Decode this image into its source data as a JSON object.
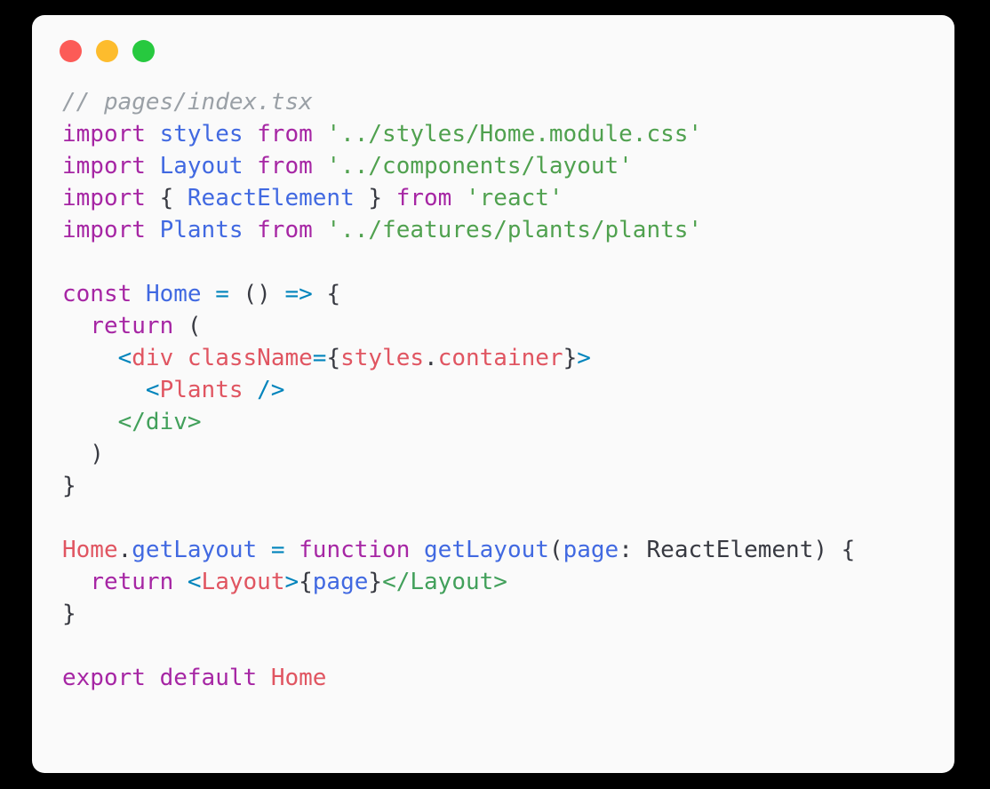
{
  "window": {
    "title": "Code Snippet Window",
    "background_color": "#000000",
    "card_color": "#fafafa",
    "controls": [
      {
        "name": "close",
        "label": "Close",
        "color": "#fc5b57"
      },
      {
        "name": "minimize",
        "label": "Minimize",
        "color": "#fdbc2d"
      },
      {
        "name": "maximize",
        "label": "Maximize",
        "color": "#27c93f"
      }
    ]
  },
  "editor": {
    "language": "tsx",
    "filename": "pages/index.tsx",
    "theme": {
      "comment": "#9aa0a6",
      "keyword": "#a626a4",
      "identifier": "#4169e1",
      "string": "#50a14f",
      "plain": "#383a42",
      "operator": "#0184bc",
      "tag": "#e05561",
      "bracket": "#0184bc",
      "close_tag": "#42a05b"
    },
    "plain_text": "// pages/index.tsx\nimport styles from '../styles/Home.module.css'\nimport Layout from '../components/layout'\nimport { ReactElement } from 'react'\nimport Plants from '../features/plants/plants'\n\nconst Home = () => {\n  return (\n    <div className={styles.container}>\n      <Plants />\n    </div>\n  )\n}\n\nHome.getLayout = function getLayout(page: ReactElement) {\n  return <Layout>{page}</Layout>\n}\n\nexport default Home\n",
    "lines": [
      {
        "n": 1,
        "tokens": [
          {
            "t": "comment",
            "v": "// pages/index.tsx"
          }
        ]
      },
      {
        "n": 2,
        "tokens": [
          {
            "t": "keyword",
            "v": "import"
          },
          {
            "t": "plain",
            "v": " "
          },
          {
            "t": "ident",
            "v": "styles"
          },
          {
            "t": "plain",
            "v": " "
          },
          {
            "t": "keyword",
            "v": "from"
          },
          {
            "t": "plain",
            "v": " "
          },
          {
            "t": "string",
            "v": "'../styles/Home.module.css'"
          }
        ]
      },
      {
        "n": 3,
        "tokens": [
          {
            "t": "keyword",
            "v": "import"
          },
          {
            "t": "plain",
            "v": " "
          },
          {
            "t": "ident",
            "v": "Layout"
          },
          {
            "t": "plain",
            "v": " "
          },
          {
            "t": "keyword",
            "v": "from"
          },
          {
            "t": "plain",
            "v": " "
          },
          {
            "t": "string",
            "v": "'../components/layout'"
          }
        ]
      },
      {
        "n": 4,
        "tokens": [
          {
            "t": "keyword",
            "v": "import"
          },
          {
            "t": "plain",
            "v": " { "
          },
          {
            "t": "ident",
            "v": "ReactElement"
          },
          {
            "t": "plain",
            "v": " } "
          },
          {
            "t": "keyword",
            "v": "from"
          },
          {
            "t": "plain",
            "v": " "
          },
          {
            "t": "string",
            "v": "'react'"
          }
        ]
      },
      {
        "n": 5,
        "tokens": [
          {
            "t": "keyword",
            "v": "import"
          },
          {
            "t": "plain",
            "v": " "
          },
          {
            "t": "ident",
            "v": "Plants"
          },
          {
            "t": "plain",
            "v": " "
          },
          {
            "t": "keyword",
            "v": "from"
          },
          {
            "t": "plain",
            "v": " "
          },
          {
            "t": "string",
            "v": "'../features/plants/plants'"
          }
        ]
      },
      {
        "n": 6,
        "tokens": []
      },
      {
        "n": 7,
        "tokens": [
          {
            "t": "keyword",
            "v": "const"
          },
          {
            "t": "plain",
            "v": " "
          },
          {
            "t": "ident",
            "v": "Home"
          },
          {
            "t": "plain",
            "v": " "
          },
          {
            "t": "operator",
            "v": "="
          },
          {
            "t": "plain",
            "v": " () "
          },
          {
            "t": "operator",
            "v": "=>"
          },
          {
            "t": "plain",
            "v": " {"
          }
        ]
      },
      {
        "n": 8,
        "tokens": [
          {
            "t": "plain",
            "v": "  "
          },
          {
            "t": "keyword",
            "v": "return"
          },
          {
            "t": "plain",
            "v": " ("
          }
        ]
      },
      {
        "n": 9,
        "tokens": [
          {
            "t": "plain",
            "v": "    "
          },
          {
            "t": "bracket",
            "v": "<"
          },
          {
            "t": "tag",
            "v": "div"
          },
          {
            "t": "plain",
            "v": " "
          },
          {
            "t": "attr",
            "v": "className"
          },
          {
            "t": "operator",
            "v": "="
          },
          {
            "t": "plain",
            "v": "{"
          },
          {
            "t": "prop",
            "v": "styles"
          },
          {
            "t": "plain",
            "v": "."
          },
          {
            "t": "prop",
            "v": "container"
          },
          {
            "t": "plain",
            "v": "}"
          },
          {
            "t": "bracket",
            "v": ">"
          }
        ]
      },
      {
        "n": 10,
        "tokens": [
          {
            "t": "plain",
            "v": "      "
          },
          {
            "t": "bracket",
            "v": "<"
          },
          {
            "t": "tag",
            "v": "Plants"
          },
          {
            "t": "plain",
            "v": " "
          },
          {
            "t": "bracket",
            "v": "/>"
          }
        ]
      },
      {
        "n": 11,
        "tokens": [
          {
            "t": "plain",
            "v": "    "
          },
          {
            "t": "closetag",
            "v": "</div>"
          }
        ]
      },
      {
        "n": 12,
        "tokens": [
          {
            "t": "plain",
            "v": "  )"
          }
        ]
      },
      {
        "n": 13,
        "tokens": [
          {
            "t": "plain",
            "v": "}"
          }
        ]
      },
      {
        "n": 14,
        "tokens": []
      },
      {
        "n": 15,
        "tokens": [
          {
            "t": "tag",
            "v": "Home"
          },
          {
            "t": "plain",
            "v": "."
          },
          {
            "t": "ident",
            "v": "getLayout"
          },
          {
            "t": "plain",
            "v": " "
          },
          {
            "t": "operator",
            "v": "="
          },
          {
            "t": "plain",
            "v": " "
          },
          {
            "t": "keyword",
            "v": "function"
          },
          {
            "t": "plain",
            "v": " "
          },
          {
            "t": "ident",
            "v": "getLayout"
          },
          {
            "t": "plain",
            "v": "("
          },
          {
            "t": "ident",
            "v": "page"
          },
          {
            "t": "plain",
            "v": ": ReactElement) {"
          }
        ]
      },
      {
        "n": 16,
        "tokens": [
          {
            "t": "plain",
            "v": "  "
          },
          {
            "t": "keyword",
            "v": "return"
          },
          {
            "t": "plain",
            "v": " "
          },
          {
            "t": "bracket",
            "v": "<"
          },
          {
            "t": "tag",
            "v": "Layout"
          },
          {
            "t": "bracket",
            "v": ">"
          },
          {
            "t": "plain",
            "v": "{"
          },
          {
            "t": "ident",
            "v": "page"
          },
          {
            "t": "plain",
            "v": "}"
          },
          {
            "t": "closetag",
            "v": "</Layout>"
          }
        ]
      },
      {
        "n": 17,
        "tokens": [
          {
            "t": "plain",
            "v": "}"
          }
        ]
      },
      {
        "n": 18,
        "tokens": []
      },
      {
        "n": 19,
        "tokens": [
          {
            "t": "keyword",
            "v": "export"
          },
          {
            "t": "plain",
            "v": " "
          },
          {
            "t": "keyword",
            "v": "default"
          },
          {
            "t": "plain",
            "v": " "
          },
          {
            "t": "tag",
            "v": "Home"
          }
        ]
      },
      {
        "n": 20,
        "tokens": []
      }
    ]
  }
}
